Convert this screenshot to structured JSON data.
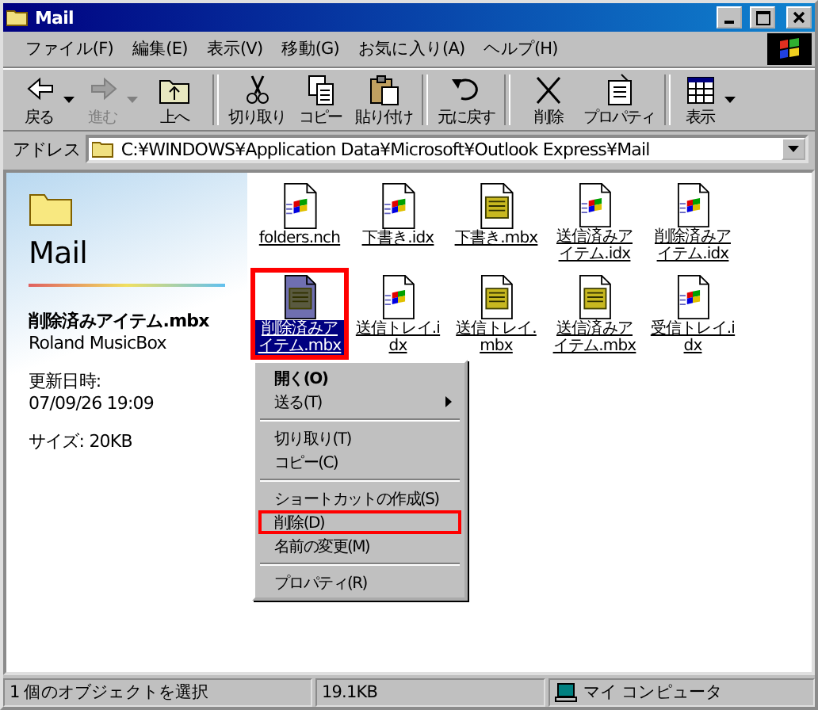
{
  "window": {
    "title": "Mail"
  },
  "menu": [
    "ファイル(F)",
    "編集(E)",
    "表示(V)",
    "移動(G)",
    "お気に入り(A)",
    "ヘルプ(H)"
  ],
  "toolbar": [
    {
      "kind": "back",
      "label": "戻る",
      "dropdown": true,
      "disabled": false
    },
    {
      "kind": "forward",
      "label": "進む",
      "dropdown": true,
      "disabled": true
    },
    {
      "kind": "up",
      "label": "上へ",
      "dropdown": false,
      "disabled": false
    },
    {
      "kind": "separator"
    },
    {
      "kind": "cut",
      "label": "切り取り",
      "dropdown": false,
      "disabled": false
    },
    {
      "kind": "copy",
      "label": "コピー",
      "dropdown": false,
      "disabled": false
    },
    {
      "kind": "paste",
      "label": "貼り付け",
      "dropdown": false,
      "disabled": false
    },
    {
      "kind": "separator"
    },
    {
      "kind": "undo",
      "label": "元に戻す",
      "dropdown": false,
      "disabled": false
    },
    {
      "kind": "separator"
    },
    {
      "kind": "delete",
      "label": "削除",
      "dropdown": false,
      "disabled": false
    },
    {
      "kind": "properties",
      "label": "プロパティ",
      "dropdown": false,
      "disabled": false
    },
    {
      "kind": "separator"
    },
    {
      "kind": "views",
      "label": "表示",
      "dropdown": true,
      "disabled": false
    }
  ],
  "address": {
    "label": "アドレス",
    "value": "C:¥WINDOWS¥Application Data¥Microsoft¥Outlook Express¥Mail"
  },
  "info_pane": {
    "folder": "Mail",
    "file_name": "削除済みアイテム.mbx",
    "file_type": "Roland MusicBox",
    "modified_label": "更新日時:",
    "modified": "07/09/26 19:09",
    "size": "サイズ: 20KB"
  },
  "files": [
    {
      "name": "folders.nch",
      "kind": "document",
      "selected": false,
      "annotated": false
    },
    {
      "name": "下書き.idx",
      "kind": "document",
      "selected": false,
      "annotated": false
    },
    {
      "name": "下書き.mbx",
      "kind": "music",
      "selected": false,
      "annotated": false
    },
    {
      "name": "送信済みアイテム.idx",
      "kind": "document",
      "selected": false,
      "annotated": false
    },
    {
      "name": "削除済みアイテム.idx",
      "kind": "document",
      "selected": false,
      "annotated": false
    },
    {
      "name": "削除済みアイテム.mbx",
      "kind": "music",
      "selected": true,
      "annotated": true
    },
    {
      "name": "送信トレイ.idx",
      "kind": "document",
      "selected": false,
      "annotated": false
    },
    {
      "name": "送信トレイ.mbx",
      "kind": "music",
      "selected": false,
      "annotated": false
    },
    {
      "name": "送信済みアイテム.mbx",
      "kind": "music",
      "selected": false,
      "annotated": false
    },
    {
      "name": "受信トレイ.idx",
      "kind": "document",
      "selected": false,
      "annotated": false
    }
  ],
  "context_menu": [
    {
      "kind": "item",
      "label": "開く(O)",
      "default": true,
      "submenu": false,
      "annotated": false
    },
    {
      "kind": "item",
      "label": "送る(T)",
      "default": false,
      "submenu": true,
      "annotated": false
    },
    {
      "kind": "separator"
    },
    {
      "kind": "item",
      "label": "切り取り(T)",
      "default": false,
      "submenu": false,
      "annotated": false
    },
    {
      "kind": "item",
      "label": "コピー(C)",
      "default": false,
      "submenu": false,
      "annotated": false
    },
    {
      "kind": "separator"
    },
    {
      "kind": "item",
      "label": "ショートカットの作成(S)",
      "default": false,
      "submenu": false,
      "annotated": false
    },
    {
      "kind": "item",
      "label": "削除(D)",
      "default": false,
      "submenu": false,
      "annotated": true
    },
    {
      "kind": "item",
      "label": "名前の変更(M)",
      "default": false,
      "submenu": false,
      "annotated": false
    },
    {
      "kind": "separator"
    },
    {
      "kind": "item",
      "label": "プロパティ(R)",
      "default": false,
      "submenu": false,
      "annotated": false
    }
  ],
  "status_bar": {
    "selection": "1 個のオブジェクトを選択",
    "size": "19.1KB",
    "zone": "マイ コンピュータ"
  }
}
